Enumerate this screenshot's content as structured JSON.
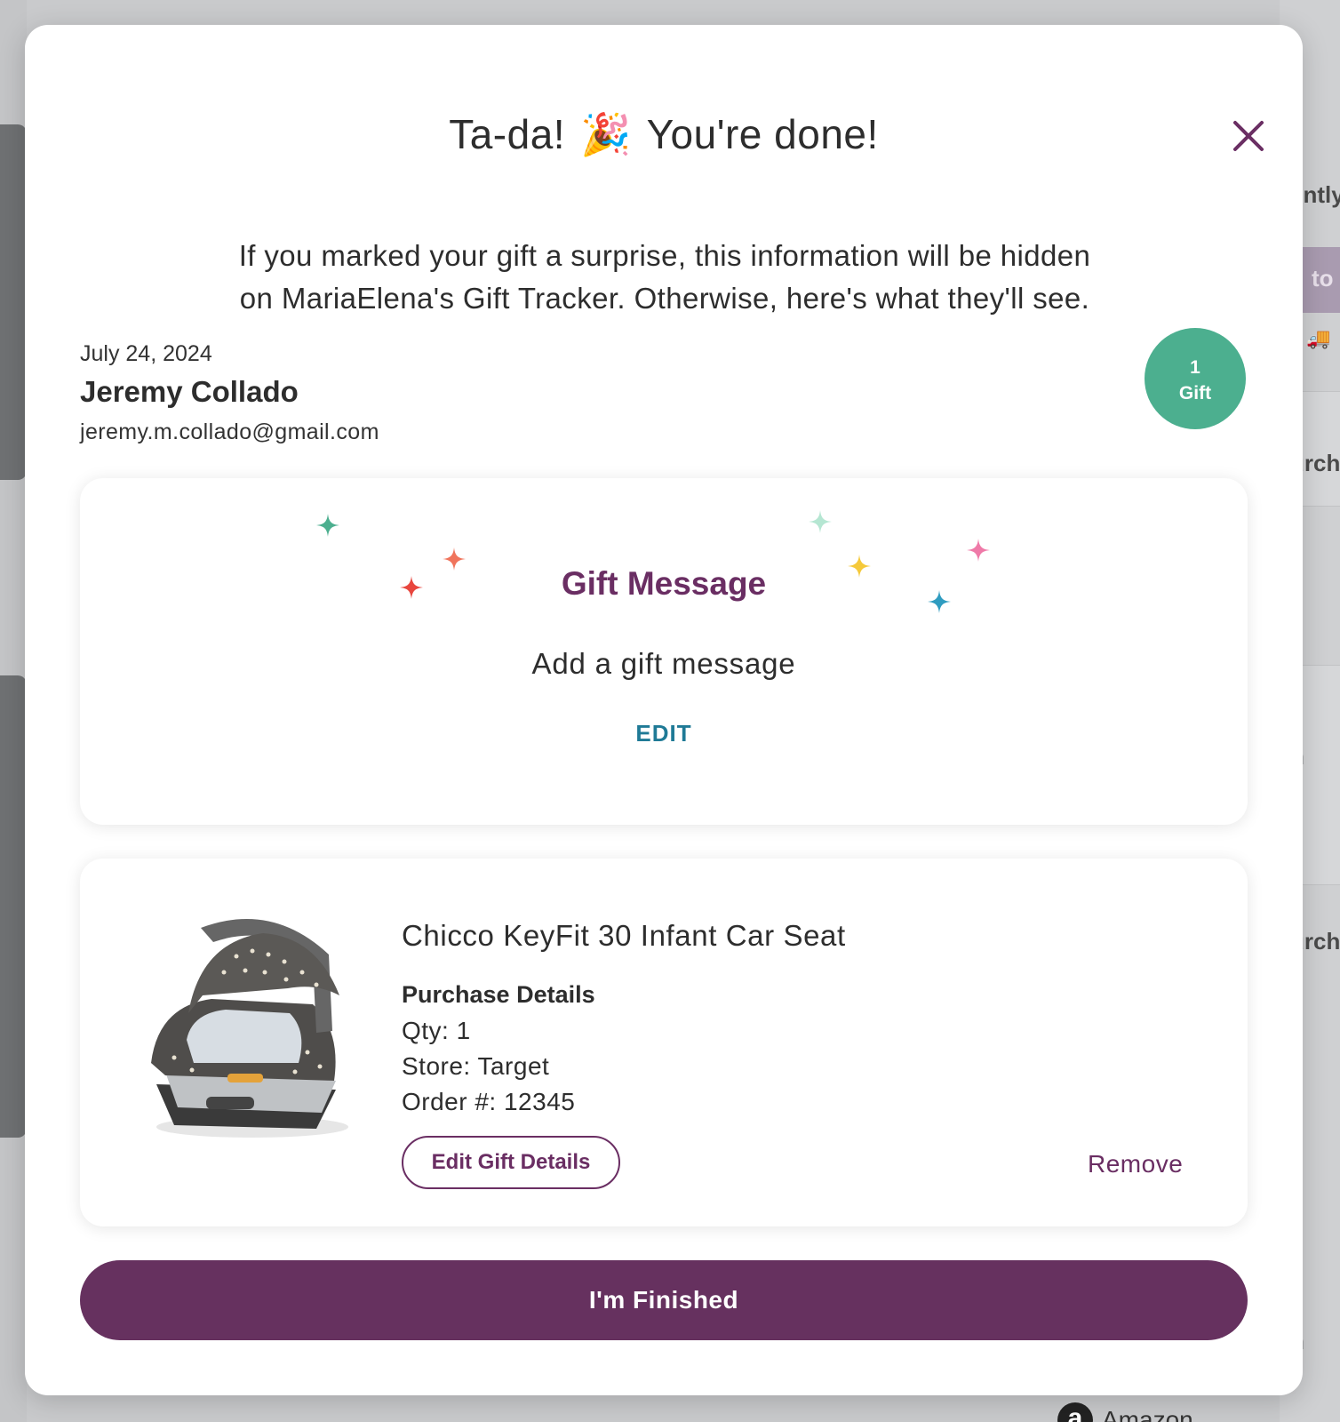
{
  "modal": {
    "title_before": "Ta-da!",
    "title_emoji": "🎉",
    "title_after": "You're done!",
    "close_label": "×",
    "intro_line1": "If you marked your gift a surprise, this information will be hidden",
    "intro_line2": "on MariaElena's Gift Tracker. Otherwise, here's what they'll see."
  },
  "giver": {
    "date": "July 24, 2024",
    "name": "Jeremy Collado",
    "email": "jeremy.m.collado@gmail.com"
  },
  "badge": {
    "count": "1",
    "label": "Gift"
  },
  "gift_message": {
    "heading": "Gift Message",
    "body": "Add a gift message",
    "edit_label": "EDIT"
  },
  "item": {
    "name": "Chicco KeyFit 30 Infant Car Seat",
    "details_heading": "Purchase Details",
    "qty": "Qty: 1",
    "store": "Store: Target",
    "order": "Order #: 12345",
    "edit_button": "Edit Gift Details",
    "remove_button": "Remove"
  },
  "finish_button": "I'm Finished",
  "background": {
    "frag_1": "ently",
    "frag_2": "to",
    "frag_3": "urch",
    "frag_4": "n",
    "frag_5": "urch",
    "frag_6": "n",
    "bottom_logo": "a",
    "bottom_text": "Amazon"
  },
  "colors": {
    "accent_purple": "#6a2e63",
    "badge_green": "#4caf8f",
    "edit_blue": "#1f7a96",
    "button_purple": "#66315f"
  }
}
